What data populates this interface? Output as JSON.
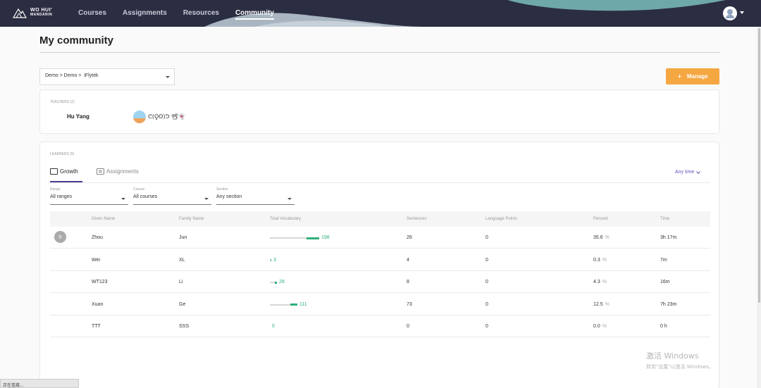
{
  "app": {
    "logo_line1": "WO HUI'",
    "logo_line2": "MANDARIN",
    "nav": [
      {
        "label": "Courses",
        "active": false
      },
      {
        "label": "Assignments",
        "active": false
      },
      {
        "label": "Resources",
        "active": false
      },
      {
        "label": "Community",
        "active": true
      }
    ]
  },
  "page": {
    "title": "My community",
    "breadcrumb": "Demo > Demo >  iFlytek",
    "manage_label": "Manage",
    "manage_icon": "plus-icon",
    "accent_color": "#f5a742"
  },
  "teachers": {
    "header": "TEACHERS (2)",
    "list": [
      {
        "name": "Hu Yang"
      },
      {
        "name": "ᕦ(ʘ̥̥ʘ)ᕤ 📽👻"
      }
    ]
  },
  "learners": {
    "header": "LEARNERS (5)",
    "tabs": [
      {
        "label": "Growth",
        "icon": "book-icon",
        "active": true
      },
      {
        "label": "Assignments",
        "icon": "list-icon",
        "active": false
      }
    ],
    "time_filter": "Any time",
    "filters": [
      {
        "label": "Range",
        "value": "All ranges"
      },
      {
        "label": "Course",
        "value": "All courses"
      },
      {
        "label": "Section",
        "value": "Any section"
      }
    ],
    "columns": [
      "Given Name",
      "Family Name",
      "Total Vocabulary",
      "Sentences",
      "Language Points",
      "Percent",
      "Time"
    ],
    "vocab_max": 198,
    "rows": [
      {
        "avatar": "h",
        "given": "Zhou",
        "family": "Jun",
        "vocab": "198",
        "vocab_value": 198,
        "sentences": "26",
        "language_points": "0",
        "percent": "35.6",
        "time": "3h 17m"
      },
      {
        "avatar": "",
        "given": "Wei",
        "family": "XL",
        "vocab": "3",
        "vocab_value": 3,
        "sentences": "4",
        "language_points": "0",
        "percent": "0.3",
        "time": "7m"
      },
      {
        "avatar": "",
        "given": "WT123",
        "family": "Li",
        "vocab": "28",
        "vocab_value": 28,
        "sentences": "8",
        "language_points": "0",
        "percent": "4.3",
        "time": "16m"
      },
      {
        "avatar": "",
        "given": "Xuan",
        "family": "Ge",
        "vocab": "111",
        "vocab_value": 111,
        "sentences": "73",
        "language_points": "0",
        "percent": "12.5",
        "time": "7h 23m"
      },
      {
        "avatar": "",
        "given": "TTT",
        "family": "SSS",
        "vocab": "0",
        "vocab_value": 0,
        "sentences": "0",
        "language_points": "0",
        "percent": "0.0",
        "time": "0 h"
      }
    ],
    "percent_unit": "%"
  },
  "system": {
    "status_text": "正在连接...",
    "watermark_line1": "激活 Windows",
    "watermark_line2": "转到\"设置\"以激活 Windows。"
  }
}
